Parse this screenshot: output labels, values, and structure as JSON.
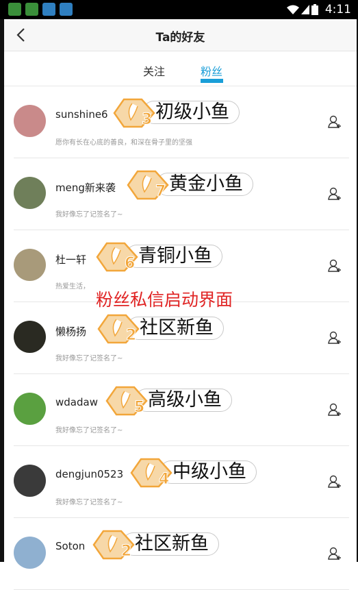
{
  "status_bar": {
    "time": "4:11",
    "app_icon_colors": [
      "#3a8f3a",
      "#3a8f3a",
      "#2f7fc0",
      "#2f7fc0"
    ]
  },
  "nav": {
    "title": "Ta的好友"
  },
  "tabs": [
    {
      "label": "关注",
      "active": false
    },
    {
      "label": "粉丝",
      "active": true
    }
  ],
  "colors": {
    "accent": "#1a9ed8",
    "badge_orange": "#f2a63a",
    "overlay_red": "#e02424"
  },
  "followers": [
    {
      "name": "sunshine6",
      "signature": "愿你有长在心底的善良，和深在骨子里的坚强",
      "level": "3",
      "rank": "初级小鱼",
      "avatar_bg": "#c98a8a",
      "add_icon": "add-friend-icon"
    },
    {
      "name": "meng新来袭",
      "signature": "我好像忘了记签名了~",
      "level": "7",
      "rank": "黄金小鱼",
      "avatar_bg": "#6f7f5a",
      "add_icon": "add-friend-icon"
    },
    {
      "name": "杜一轩",
      "signature": "热爱生活，",
      "level": "6",
      "rank": "青铜小鱼",
      "avatar_bg": "#a89a7a",
      "add_icon": "add-friend-icon"
    },
    {
      "name": "懒杨扬",
      "signature": "我好像忘了记签名了~",
      "level": "2",
      "rank": "社区新鱼",
      "avatar_bg": "#2a2a22",
      "add_icon": "add-friend-icon"
    },
    {
      "name": "wdadaw",
      "signature": "我好像忘了记签名了~",
      "level": "5",
      "rank": "高级小鱼",
      "avatar_bg": "#5aa040",
      "add_icon": "add-friend-icon"
    },
    {
      "name": "dengjun0523",
      "signature": "我好像忘了记签名了~",
      "level": "4",
      "rank": "中级小鱼",
      "avatar_bg": "#3a3a3a",
      "add_icon": "add-friend-icon"
    },
    {
      "name": "Soton",
      "signature": "",
      "level": "2",
      "rank": "社区新鱼",
      "avatar_bg": "#8fb0d0",
      "add_icon": "add-friend-icon"
    }
  ],
  "overlay_caption": "粉丝私信启动界面"
}
